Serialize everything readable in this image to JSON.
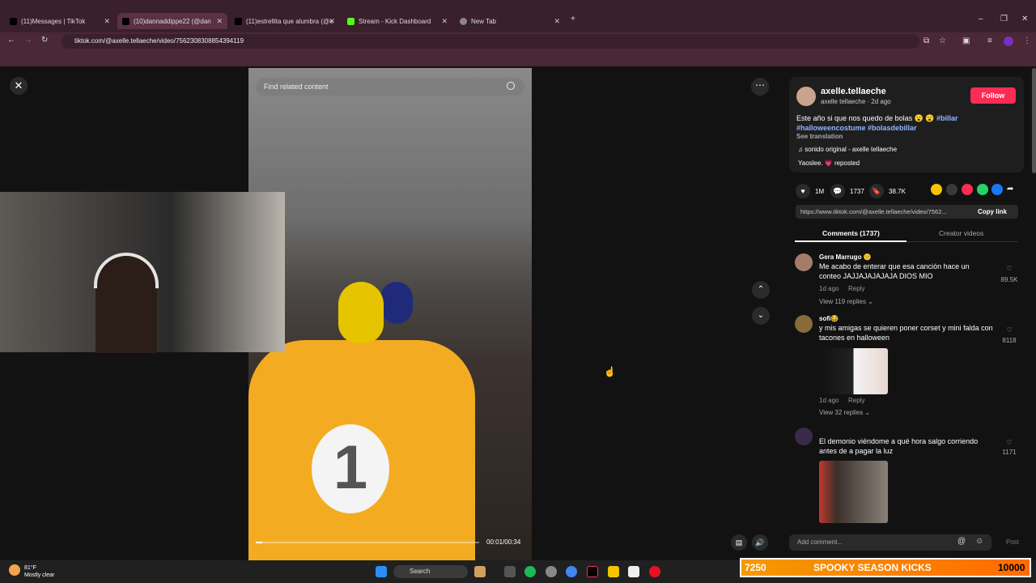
{
  "browser": {
    "tabs": [
      {
        "label": "(11)Messages | TikTok",
        "favicon_color": "#000000"
      },
      {
        "label": "(10)dannaddippe22 (@dan",
        "favicon_color": "#000000"
      },
      {
        "label": "(11)estrellita que alumbra (@e",
        "favicon_color": "#000000"
      },
      {
        "label": "Stream - Kick Dashboard",
        "favicon_color": "#53fc18"
      },
      {
        "label": "New Tab",
        "favicon_color": "#888888"
      }
    ],
    "new_tab_symbol": "+",
    "url": "tiktok.com/@axelle.tellaeche/video/7562308308854394119"
  },
  "player": {
    "search_placeholder": "Find related content",
    "timecode": "00:01/00:34",
    "progress_fraction": 0.03,
    "badge_symbol": "1"
  },
  "author": {
    "username": "axelle.tellaeche",
    "subline": "axelle tellaeche · 2d ago",
    "follow_label": "Follow"
  },
  "caption": {
    "text": "Este año si que nos quedo de bolas 😮 😮",
    "tags": [
      "#billar",
      "#halloweencostume",
      "#bolasdebillar"
    ],
    "see_translation": "See translation",
    "sound": "♫  sonido original - axelle tellaeche",
    "repost": "Yaoslee. 💗 reposted"
  },
  "stats": {
    "likes": "1M",
    "comments": "1737",
    "saves": "38.7K",
    "share_colors": [
      "#f5c400",
      "#3a3a3a",
      "#fe2c55",
      "#25d366",
      "#1877f2"
    ]
  },
  "link": {
    "url": "https://www.tiktok.com/@axelle.tellaeche/video/7562...",
    "copy_label": "Copy link"
  },
  "comment_tabs": {
    "comments": "Comments (1737)",
    "creator": "Creator videos"
  },
  "comments": [
    {
      "name": "Gera Marrugo 😕",
      "text": "Me acabo de enterar que esa canción hace un conteo JAJJAJAJAJAJA DIOS MIO",
      "time": "1d ago",
      "reply": "Reply",
      "replies": "View 119 replies ⌄",
      "likes": "89.5K"
    },
    {
      "name": "sofi😂",
      "text": "y mis amigas se quieren poner corset y mini falda con tacones en halloween",
      "time": "1d ago",
      "reply": "Reply",
      "replies": "View 32 replies ⌄",
      "likes": "8118"
    },
    {
      "name": "",
      "text": "El demonio viéndome a qué hora salgo corriendo antes de a pagar la luz",
      "likes": "1171"
    }
  ],
  "composer": {
    "placeholder": "Add comment...",
    "post_label": "Post"
  },
  "taskbar": {
    "temp": "81°F",
    "weather": "Mostly clear",
    "search_label": "Search"
  },
  "stream_overlay": {
    "left_number": "7250",
    "title": "SPOOKY SEASON KICKS",
    "right_number": "10000"
  }
}
